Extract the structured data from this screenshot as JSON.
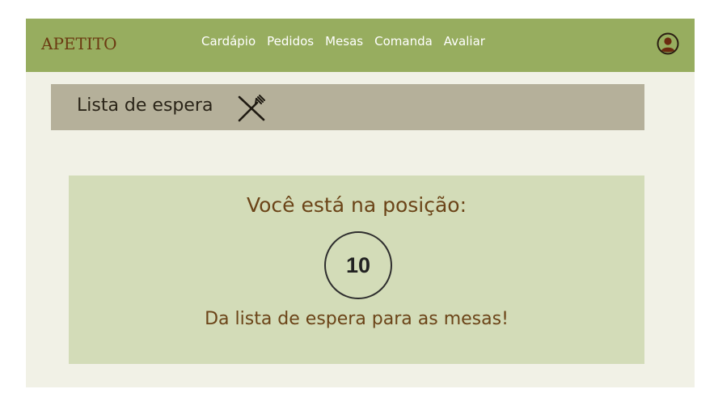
{
  "app": {
    "brand": "APETITO"
  },
  "nav": {
    "items": [
      {
        "label": "Cardápio"
      },
      {
        "label": "Pedidos"
      },
      {
        "label": "Mesas"
      },
      {
        "label": "Comanda"
      },
      {
        "label": "Avaliar"
      }
    ],
    "avatar_icon": "user-circle-icon"
  },
  "header": {
    "title": "Lista de espera",
    "icon": "cutlery-icon"
  },
  "queue": {
    "label": "Você está na posição:",
    "position": "10",
    "subtitle": "Da lista de espera para as mesas!"
  },
  "colors": {
    "navbar": "#97ad5f",
    "brand": "#6b3a12",
    "background": "#f1f1e6",
    "header_bar": "#b5b09a",
    "card": "#d3dcb8",
    "text_brown": "#6b4418"
  }
}
